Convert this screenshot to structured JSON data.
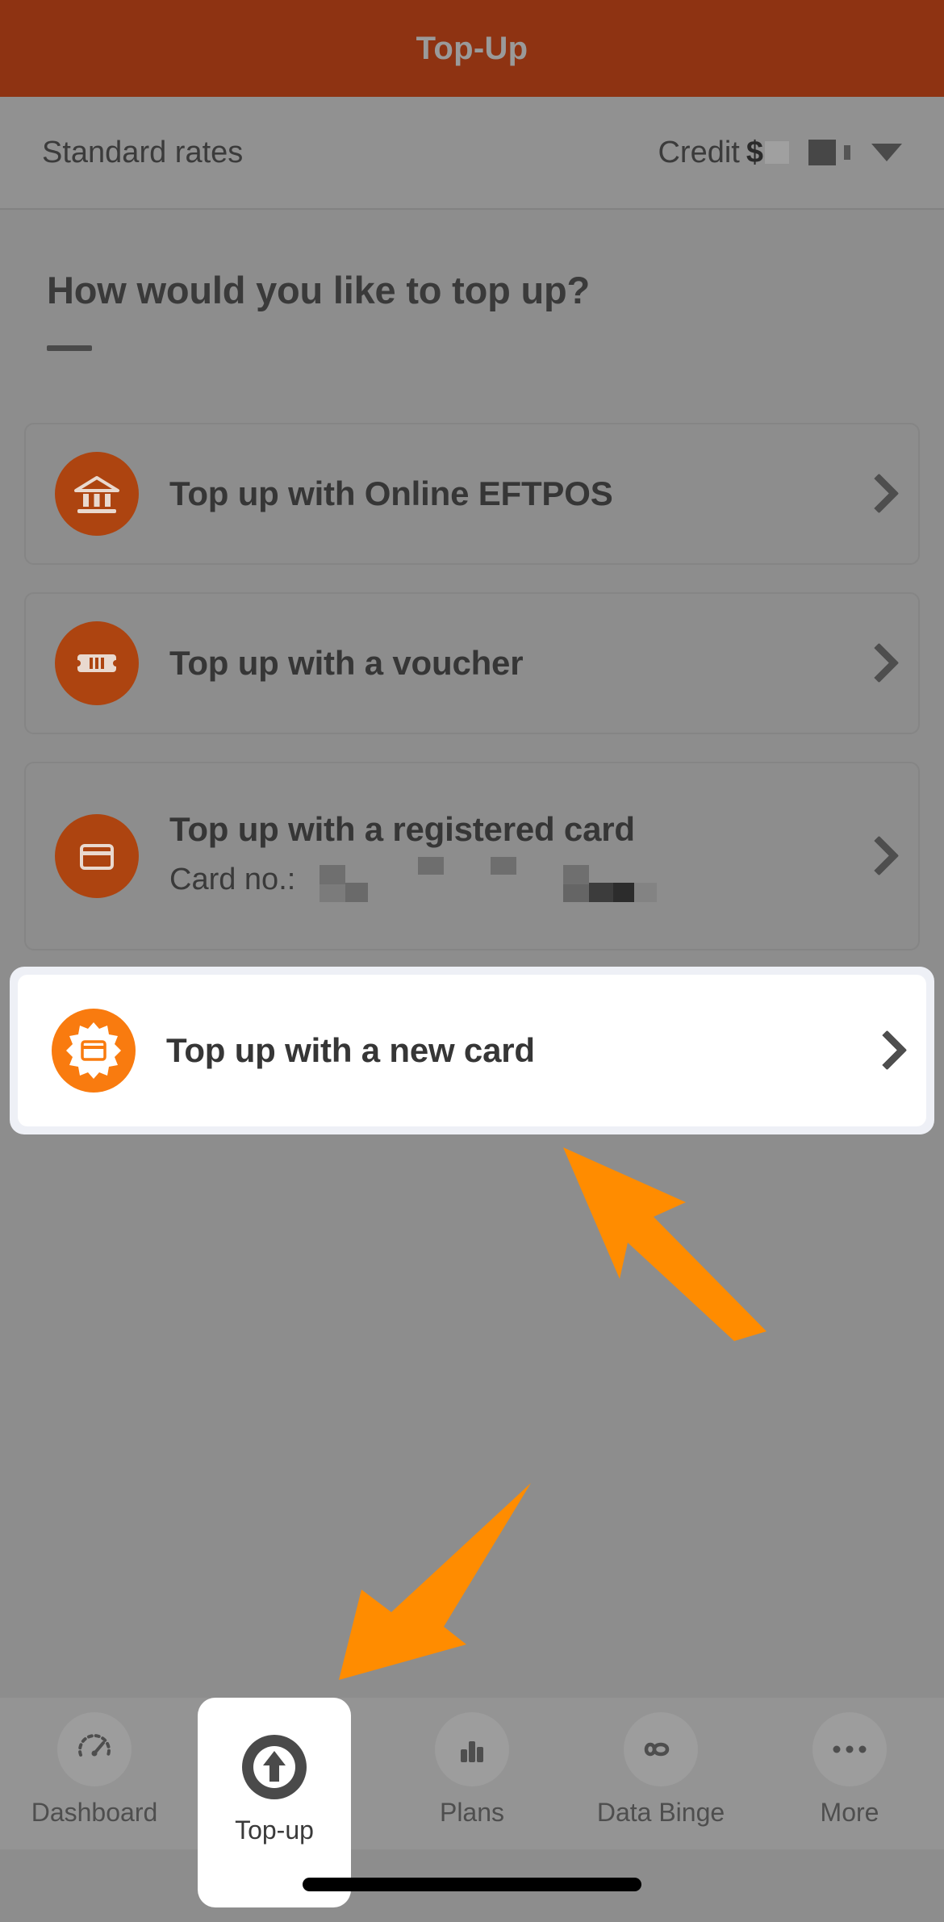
{
  "header": {
    "title": "Top-Up"
  },
  "rates_bar": {
    "label": "Standard rates",
    "credit_label": "Credit",
    "credit_currency": "$",
    "credit_value_redacted": true,
    "dropdown_icon": "chevron-down-icon"
  },
  "main": {
    "heading": "How would you like to top up?",
    "options": [
      {
        "title": "Top up with Online EFTPOS",
        "icon": "bank-icon",
        "icon_color": "#ad4410",
        "chevron": "chevron-right-icon",
        "highlighted": false
      },
      {
        "title": "Top up with a voucher",
        "icon": "voucher-ticket-icon",
        "icon_color": "#ad4410",
        "chevron": "chevron-right-icon",
        "highlighted": false
      },
      {
        "title": "Top up with a registered card",
        "subtitle_label": "Card no.:",
        "subtitle_value_redacted": true,
        "icon": "credit-card-icon",
        "icon_color": "#ad4410",
        "chevron": "chevron-right-icon",
        "highlighted": false
      },
      {
        "title": "Top up with a new card",
        "icon": "new-card-starburst-icon",
        "icon_color": "#f97b0f",
        "chevron": "chevron-right-icon",
        "highlighted": true
      }
    ]
  },
  "annotations": {
    "arrow_color": "#FF8C00",
    "arrows": [
      {
        "name": "arrow-pointing-to-new-card",
        "direction": "up-left"
      },
      {
        "name": "arrow-pointing-to-topup-tab",
        "direction": "down-left"
      }
    ]
  },
  "bottom_nav": {
    "items": [
      {
        "label": "Dashboard",
        "icon": "speedometer-icon",
        "active": false
      },
      {
        "label": "Top-up",
        "icon": "arrow-up-circle-icon",
        "active": true
      },
      {
        "label": "Plans",
        "icon": "bar-chart-icon",
        "active": false
      },
      {
        "label": "Data Binge",
        "icon": "infinity-icon",
        "active": false
      },
      {
        "label": "More",
        "icon": "ellipsis-icon",
        "active": false
      }
    ]
  },
  "colors": {
    "header_bg": "#8e3312",
    "page_bg": "#8d8d8d",
    "accent_orange": "#ad4410",
    "bright_orange": "#f97b0f",
    "annotation_orange": "#FF8C00"
  }
}
